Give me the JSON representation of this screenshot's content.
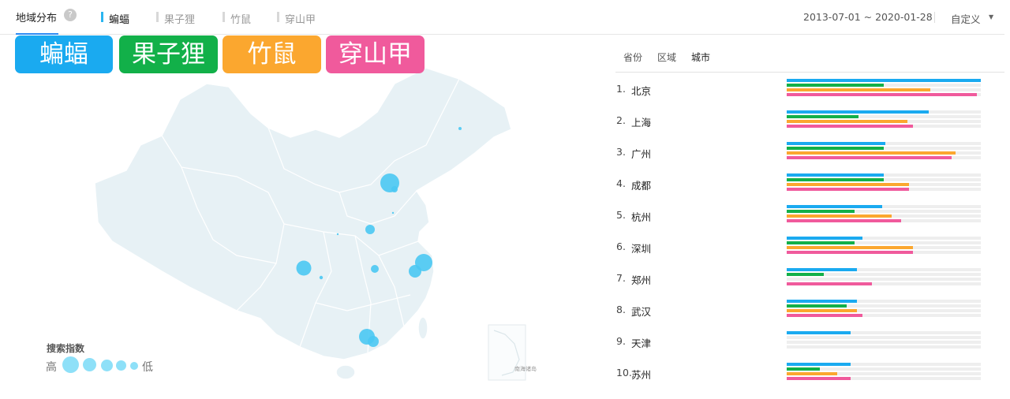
{
  "header": {
    "title": "地域分布",
    "help_glyph": "?",
    "tabs": [
      {
        "label": "蝙蝠",
        "active": true
      },
      {
        "label": "果子狸",
        "active": false
      },
      {
        "label": "竹鼠",
        "active": false
      },
      {
        "label": "穿山甲",
        "active": false
      }
    ],
    "date_range": "2013-07-01 ~ 2020-01-28",
    "custom_label": "自定义",
    "custom_caret": "▼"
  },
  "keywords": [
    {
      "label": "蝙蝠",
      "color": "#1aaaf0"
    },
    {
      "label": "果子狸",
      "color": "#12b049"
    },
    {
      "label": "竹鼠",
      "color": "#fba72f"
    },
    {
      "label": "穿山甲",
      "color": "#f05a9c"
    }
  ],
  "map_legend": {
    "title": "搜索指数",
    "high": "高",
    "low": "低"
  },
  "inset_map_label": "南海诸岛",
  "subtabs": [
    {
      "label": "省份",
      "active": false
    },
    {
      "label": "区域",
      "active": false
    },
    {
      "label": "城市",
      "active": true
    }
  ],
  "ranking": [
    {
      "rank": "1.",
      "city": "北京",
      "values": [
        1.0,
        0.5,
        0.74,
        0.98
      ]
    },
    {
      "rank": "2.",
      "city": "上海",
      "values": [
        0.73,
        0.37,
        0.62,
        0.65
      ]
    },
    {
      "rank": "3.",
      "city": "广州",
      "values": [
        0.51,
        0.5,
        0.87,
        0.85
      ]
    },
    {
      "rank": "4.",
      "city": "成都",
      "values": [
        0.5,
        0.5,
        0.63,
        0.63
      ]
    },
    {
      "rank": "5.",
      "city": "杭州",
      "values": [
        0.49,
        0.35,
        0.54,
        0.59
      ]
    },
    {
      "rank": "6.",
      "city": "深圳",
      "values": [
        0.39,
        0.35,
        0.65,
        0.65
      ]
    },
    {
      "rank": "7.",
      "city": "郑州",
      "values": [
        0.36,
        0.19,
        0.0,
        0.44
      ]
    },
    {
      "rank": "8.",
      "city": "武汉",
      "values": [
        0.36,
        0.31,
        0.36,
        0.39
      ]
    },
    {
      "rank": "9.",
      "city": "天津",
      "values": [
        0.33,
        0.0,
        0.0,
        0.0
      ]
    },
    {
      "rank": "10.",
      "city": "苏州",
      "values": [
        0.33,
        0.17,
        0.26,
        0.33
      ]
    }
  ]
}
